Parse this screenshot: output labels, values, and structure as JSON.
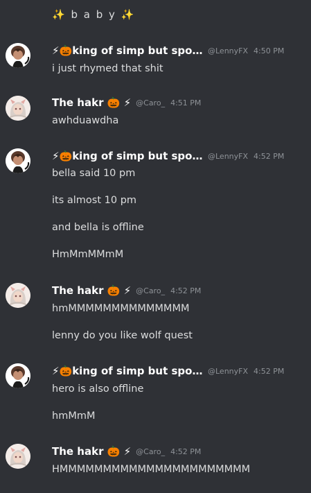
{
  "top_message": "✨ b a b y ✨",
  "users": {
    "lenny": {
      "name": "⚡🎃king of simp but spo...",
      "handle": "@LennyFX"
    },
    "caro": {
      "name": "The hakr 🎃 ⚡",
      "handle": "@Caro_"
    }
  },
  "messages": [
    {
      "time": "4:50 PM",
      "lines": [
        "i just rhymed that shit"
      ]
    },
    {
      "time": "4:51 PM",
      "lines": [
        "awhduawdha"
      ]
    },
    {
      "time": "4:52 PM",
      "lines": [
        "bella said 10 pm",
        "its almost 10 pm",
        "and bella is offline",
        "HmMmMMmM"
      ]
    },
    {
      "time": "4:52 PM",
      "lines": [
        "hmMMMMMMMMMMMMMM",
        "lenny do you like wolf quest"
      ]
    },
    {
      "time": "4:52 PM",
      "lines": [
        "hero is also offline",
        "hmMmM"
      ]
    },
    {
      "time": "4:52 PM",
      "lines": [
        "HMMMMMMMMMMMMMMMMMMMMMM"
      ]
    }
  ]
}
